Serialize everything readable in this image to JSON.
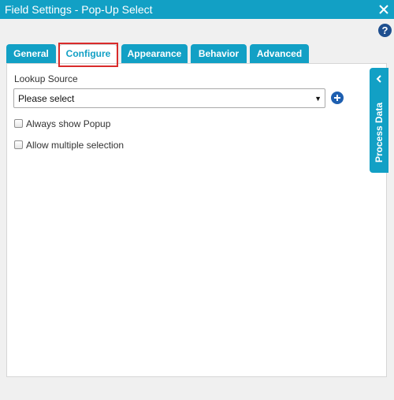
{
  "window": {
    "title": "Field Settings - Pop-Up Select",
    "close_icon": "close-icon",
    "help_label": "?"
  },
  "tabs": [
    {
      "label": "General",
      "active": false
    },
    {
      "label": "Configure",
      "active": true
    },
    {
      "label": "Appearance",
      "active": false
    },
    {
      "label": "Behavior",
      "active": false
    },
    {
      "label": "Advanced",
      "active": false
    }
  ],
  "configure": {
    "lookup_source_label": "Lookup Source",
    "lookup_source_value": "Please select",
    "add_icon": "plus-circle-icon",
    "always_show_popup": {
      "label": "Always show Popup",
      "checked": false
    },
    "allow_multiple_selection": {
      "label": "Allow multiple selection",
      "checked": false
    }
  },
  "side_panel": {
    "label": "Process Data",
    "icon": "chevron-left-icon"
  },
  "colors": {
    "accent": "#12a0c5",
    "highlight": "#d92b2b",
    "help": "#1e4f8f",
    "add": "#1e5fb0"
  }
}
